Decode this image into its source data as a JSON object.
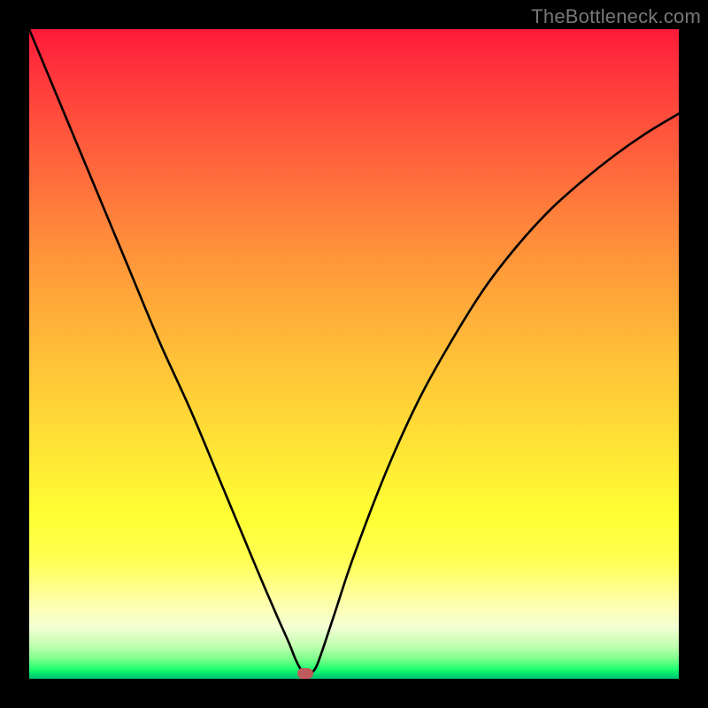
{
  "watermark": "TheBottleneck.com",
  "colors": {
    "frame": "#000000",
    "curve": "#000000",
    "marker": "#c15a5a"
  },
  "chart_data": {
    "type": "line",
    "title": "",
    "xlabel": "",
    "ylabel": "",
    "xlim": [
      0,
      100
    ],
    "ylim": [
      0,
      100
    ],
    "grid": false,
    "series": [
      {
        "name": "bottleneck-curve",
        "x": [
          0,
          5,
          10,
          15,
          20,
          25,
          30,
          35,
          38,
          40,
          41,
          42,
          43,
          44,
          45,
          47,
          50,
          55,
          60,
          65,
          70,
          75,
          80,
          85,
          90,
          95,
          100
        ],
        "y": [
          100,
          88,
          76,
          64,
          52,
          41,
          29,
          17,
          10,
          5.5,
          3,
          1.2,
          0.8,
          1.5,
          4,
          10,
          19,
          32,
          43,
          52,
          60,
          66.5,
          72,
          76.5,
          80.5,
          84,
          87
        ]
      }
    ],
    "marker": {
      "x": 42.5,
      "y": 0.5
    },
    "background_gradient": [
      "#ff1a3a",
      "#ff3a3c",
      "#ff6a3c",
      "#ff953a",
      "#ffbf38",
      "#ffe336",
      "#ffff33",
      "#ffff55",
      "#ffffa8",
      "#f4ffd4",
      "#c0ffb0",
      "#7aff8a",
      "#20ff70",
      "#00e070",
      "#00c070"
    ]
  }
}
